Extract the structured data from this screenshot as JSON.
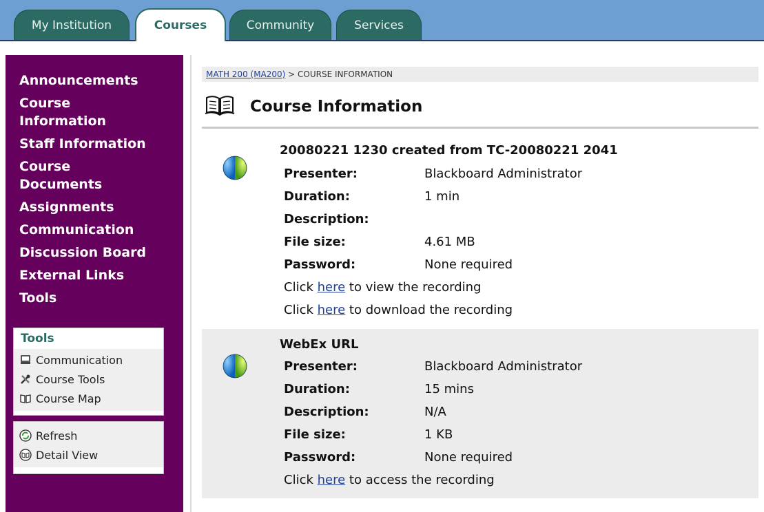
{
  "tabs": [
    {
      "label": "My Institution",
      "active": false
    },
    {
      "label": "Courses",
      "active": true
    },
    {
      "label": "Community",
      "active": false
    },
    {
      "label": "Services",
      "active": false
    }
  ],
  "nav": {
    "links": [
      "Announcements",
      "Course Information",
      "Staff Information",
      "Course Documents",
      "Assignments",
      "Communication",
      "Discussion Board",
      "External Links",
      "Tools"
    ]
  },
  "tools_box": {
    "title": "Tools",
    "items": [
      {
        "label": "Communication",
        "icon": "computer-icon"
      },
      {
        "label": "Course Tools",
        "icon": "tools-icon"
      },
      {
        "label": "Course Map",
        "icon": "book-icon"
      }
    ]
  },
  "actions_box": {
    "items": [
      {
        "label": "Refresh",
        "icon": "refresh-icon"
      },
      {
        "label": "Detail View",
        "icon": "detail-view-icon"
      }
    ]
  },
  "breadcrumb": {
    "link": "MATH 200 (MA200)",
    "separator": " > ",
    "current": "COURSE INFORMATION"
  },
  "page_title": "Course Information",
  "recordings": [
    {
      "title": "20080221 1230 created from TC-20080221 2041",
      "fields": [
        {
          "key": "Presenter:",
          "value": "Blackboard Administrator"
        },
        {
          "key": "Duration:",
          "value": "1 min"
        },
        {
          "key": "Description:",
          "value": ""
        },
        {
          "key": "File size:",
          "value": "4.61 MB"
        },
        {
          "key": "Password:",
          "value": "None required"
        }
      ],
      "links": [
        {
          "pre": "Click ",
          "link": "here",
          "post": " to view the recording"
        },
        {
          "pre": "Click ",
          "link": "here",
          "post": " to download the recording"
        }
      ]
    },
    {
      "title": "WebEx URL",
      "fields": [
        {
          "key": "Presenter:",
          "value": "Blackboard Administrator"
        },
        {
          "key": "Duration:",
          "value": "15 mins"
        },
        {
          "key": "Description:",
          "value": "N/A"
        },
        {
          "key": "File size:",
          "value": "1 KB"
        },
        {
          "key": "Password:",
          "value": "None required"
        }
      ],
      "links": [
        {
          "pre": "Click ",
          "link": "here",
          "post": " to access the recording"
        }
      ]
    }
  ],
  "colors": {
    "topbar": "#6d9fd2",
    "tab": "#2b6b63",
    "leftnav": "#65005c",
    "link": "#1f3f9a"
  }
}
